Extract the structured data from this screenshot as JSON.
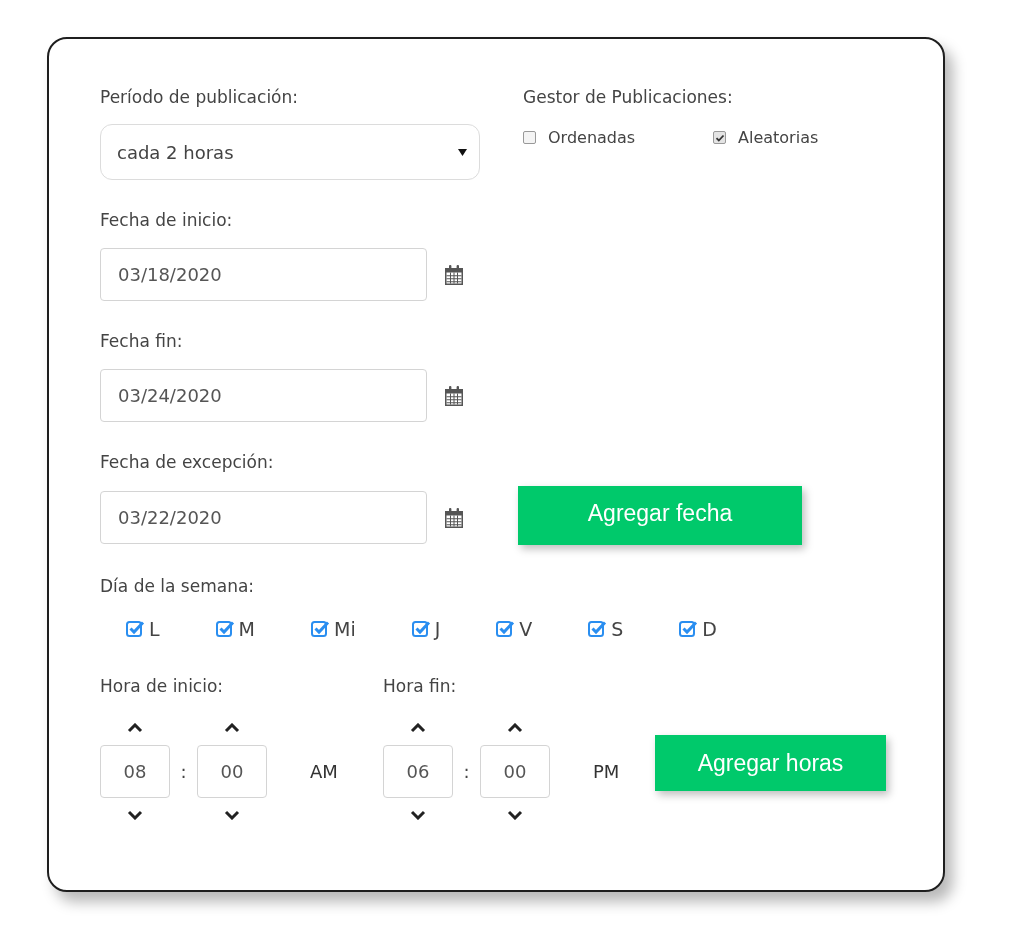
{
  "publication_period": {
    "label": "Período de publicación:",
    "value": "cada 2 horas"
  },
  "publication_manager": {
    "label": "Gestor de Publicaciones:",
    "options": [
      {
        "label": "Ordenadas",
        "checked": false
      },
      {
        "label": "Aleatorias",
        "checked": true
      }
    ]
  },
  "date_fields": [
    {
      "label": "Fecha de inicio:",
      "value": "03/18/2020"
    },
    {
      "label": "Fecha fin:",
      "value": "03/24/2020"
    },
    {
      "label": "Fecha de excepción:",
      "value": "03/22/2020",
      "action": "Agregar fecha"
    }
  ],
  "weekdays": {
    "label": "Día de la semana:",
    "days": [
      {
        "label": "L",
        "checked": true
      },
      {
        "label": "M",
        "checked": true
      },
      {
        "label": "Mi",
        "checked": true
      },
      {
        "label": "J",
        "checked": true
      },
      {
        "label": "V",
        "checked": true
      },
      {
        "label": "S",
        "checked": true
      },
      {
        "label": "D",
        "checked": true
      }
    ]
  },
  "times": [
    {
      "label": "Hora de inicio:",
      "hour": "08",
      "separator": ":",
      "minute": "00",
      "period": "AM"
    },
    {
      "label": "Hora fin:",
      "hour": "06",
      "separator": ":",
      "minute": "00",
      "period": "PM"
    }
  ],
  "add_hours_button": "Agregar horas"
}
